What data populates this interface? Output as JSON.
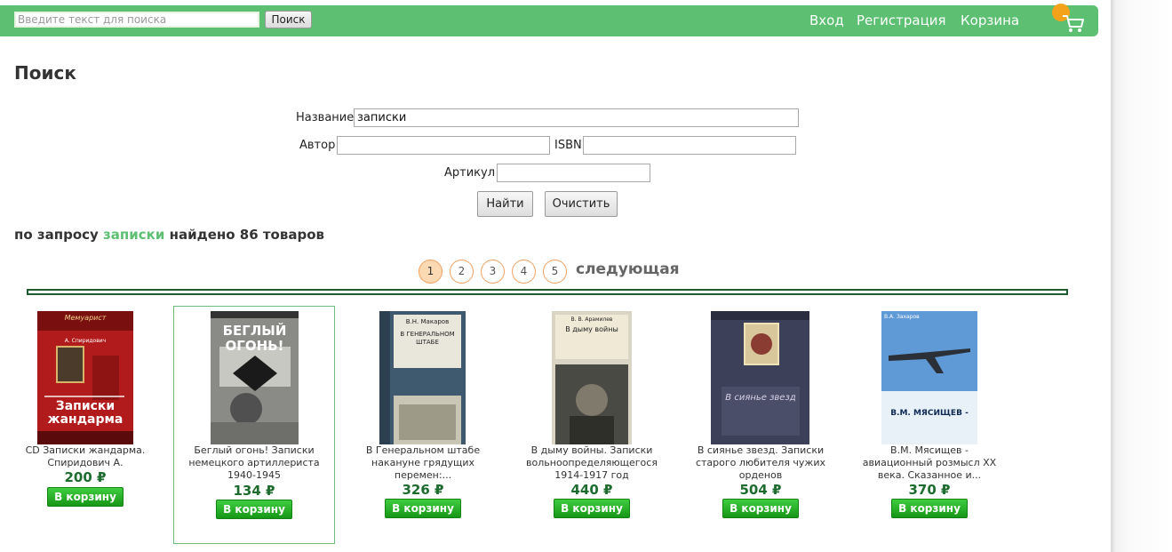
{
  "colors": {
    "accent": "#5cbf72",
    "price": "#1d6b2e",
    "buy_button": "#1fa51f",
    "page_active": "#fbd9b3"
  },
  "header": {
    "search_placeholder": "Введите текст для поиска",
    "search_button": "Поиск",
    "login": "Вход",
    "register": "Регистрация",
    "cart": "Корзина",
    "cart_icon": "shopping-cart-icon"
  },
  "search": {
    "title": "Поиск",
    "name_label": "Название",
    "name_value": "записки",
    "author_label": "Автор",
    "author_value": "",
    "isbn_label": "ISBN",
    "isbn_value": "",
    "article_label": "Артикул",
    "article_value": "",
    "find_button": "Найти",
    "clear_button": "Очистить"
  },
  "results": {
    "prefix": "по запросу",
    "query": "записки",
    "suffix": "найдено 86 товаров"
  },
  "pagination": {
    "pages": [
      "1",
      "2",
      "3",
      "4",
      "5"
    ],
    "active": "1",
    "next": "следующая"
  },
  "products": [
    {
      "title": "CD Записки жандарма. Спиридович А.",
      "price": "200 ₽",
      "button": "В корзину",
      "cover_text": "Записки жандарма",
      "cover_author": "А. Спиридович"
    },
    {
      "title": "Беглый огонь! Записки немецкого артиллериста 1940-1945",
      "price": "134 ₽",
      "button": "В корзину",
      "cover_text": "БЕГЛЫЙ ОГОНЬ!",
      "cover_author": ""
    },
    {
      "title": "В Генеральном штабе накануне грядущих перемен:...",
      "price": "326 ₽",
      "button": "В корзину",
      "cover_text": "В ГЕНЕРАЛЬНОМ ШТАБЕ",
      "cover_author": "В.Н. Макаров"
    },
    {
      "title": "В дыму войны. Записки вольноопределяющегося 1914-1917 год",
      "price": "440 ₽",
      "button": "В корзину",
      "cover_text": "В дыму войны",
      "cover_author": "В. В. Арамилев"
    },
    {
      "title": "В сиянье звезд. Записки старого любителя чужих орденов",
      "price": "504 ₽",
      "button": "В корзину",
      "cover_text": "В сиянье звезд",
      "cover_author": ""
    },
    {
      "title": "В.М. Мясищев - авиационный розмысл XX века. Сказанное и...",
      "price": "370 ₽",
      "button": "В корзину",
      "cover_text": "В.М. МЯСИЩЕВ -",
      "cover_author": "В.А. Захаров"
    }
  ]
}
